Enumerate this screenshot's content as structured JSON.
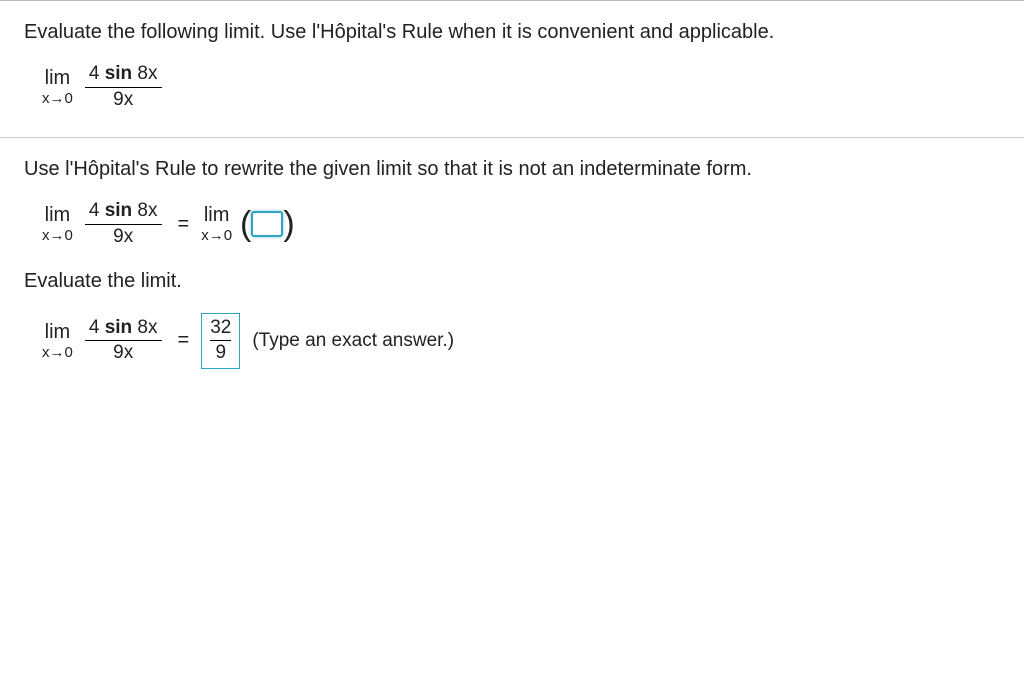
{
  "question": {
    "prompt": "Evaluate the following limit. Use l'Hôpital's Rule when it is convenient and applicable.",
    "limit_expr": {
      "lim_label": "lim",
      "approach": "x→0",
      "numerator_prefix": "4 ",
      "numerator_func": "sin",
      "numerator_suffix": " 8x",
      "denominator": "9x"
    }
  },
  "part1": {
    "instruction": "Use l'Hôpital's Rule to rewrite the given limit so that it is not an indeterminate form.",
    "lhs": {
      "lim_label": "lim",
      "approach": "x→0",
      "numerator_prefix": "4 ",
      "numerator_func": "sin",
      "numerator_suffix": " 8x",
      "denominator": "9x"
    },
    "equals": "=",
    "rhs_lim": {
      "lim_label": "lim",
      "approach": "x→0"
    },
    "paren_left": "(",
    "paren_right": ")"
  },
  "part2": {
    "instruction": "Evaluate the limit.",
    "lhs": {
      "lim_label": "lim",
      "approach": "x→0",
      "numerator_prefix": "4 ",
      "numerator_func": "sin",
      "numerator_suffix": " 8x",
      "denominator": "9x"
    },
    "equals": "=",
    "answer_num": "32",
    "answer_den": "9",
    "hint": "(Type an exact answer.)"
  }
}
